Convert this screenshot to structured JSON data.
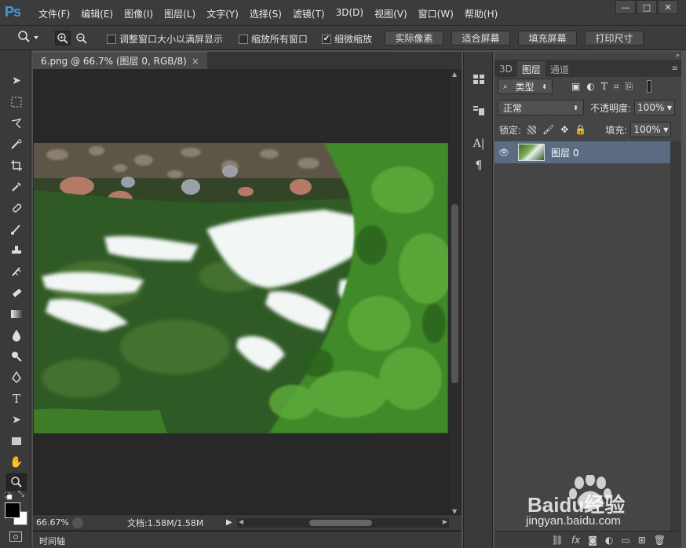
{
  "app": {
    "logo": "Ps"
  },
  "menu": [
    "文件(F)",
    "编辑(E)",
    "图像(I)",
    "图层(L)",
    "文字(Y)",
    "选择(S)",
    "滤镜(T)",
    "3D(D)",
    "视图(V)",
    "窗口(W)",
    "帮助(H)"
  ],
  "window_buttons": {
    "minimize": "—",
    "maximize": "□",
    "close": "✕"
  },
  "options": {
    "resize_windows": "调整窗口大小以满屏显示",
    "zoom_all": "缩放所有窗口",
    "scrubby_zoom": "细微缩放",
    "btn_actual": "实际像素",
    "btn_fit": "适合屏幕",
    "btn_fill": "填充屏幕",
    "btn_print": "打印尺寸",
    "scrubby_checked": true
  },
  "document": {
    "tab_title": "6.png @ 66.7% (图层 0, RGB/8)",
    "tab_close": "×",
    "zoom_level": "66.67%",
    "doc_info": "文档:1.58M/1.58M"
  },
  "timeline": {
    "label": "时间轴"
  },
  "panel": {
    "tabs": [
      "3D",
      "图层",
      "通道"
    ],
    "active_tab": "图层",
    "filter_kind": "类型",
    "blend_mode": "正常",
    "opacity_label": "不透明度:",
    "opacity_value": "100%",
    "lock_label": "锁定:",
    "fill_label": "填充:",
    "fill_value": "100%",
    "layers": [
      {
        "name": "图层 0",
        "visible": true
      }
    ]
  },
  "watermark": {
    "text": "Baidu经验",
    "url": "jingyan.baidu.com"
  },
  "colors": {
    "accent": "#3a9be5",
    "selected_layer": "#5b6b82"
  }
}
